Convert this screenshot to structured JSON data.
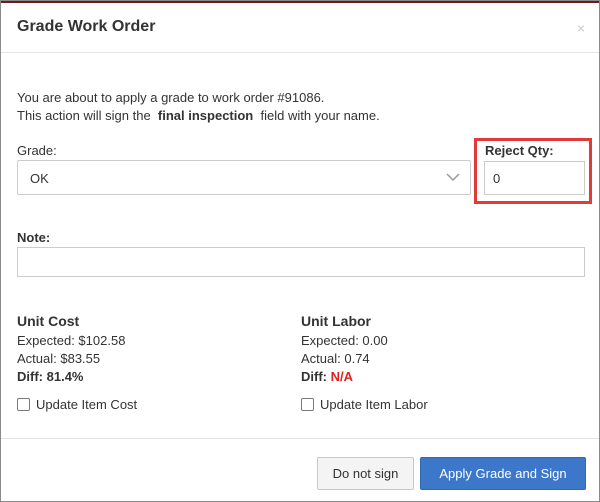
{
  "modal": {
    "title": "Grade Work Order",
    "close_glyph": "×"
  },
  "intro": {
    "line1": "You are about to apply a grade to work order #91086.",
    "line2_prefix": "This action will sign the",
    "line2_bold": "final inspection",
    "line2_suffix": "field with your name."
  },
  "grade": {
    "label": "Grade:",
    "selected": "OK",
    "icon": "chevron-down-icon"
  },
  "reject": {
    "label": "Reject Qty:",
    "value": "0",
    "highlight_color": "#e03a3a"
  },
  "note": {
    "label": "Note:",
    "value": ""
  },
  "unit_cost": {
    "title": "Unit Cost",
    "expected": "Expected: $102.58",
    "actual": "Actual: $83.55",
    "diff_label": "Diff:",
    "diff_value": "81.4%",
    "checkbox_label": "Update Item Cost",
    "checked": false
  },
  "unit_labor": {
    "title": "Unit Labor",
    "expected": "Expected: 0.00",
    "actual": "Actual: 0.74",
    "diff_label": "Diff:",
    "diff_value": "N/A",
    "diff_color": "#e02020",
    "checkbox_label": "Update Item Labor",
    "checked": false
  },
  "footer": {
    "cancel_label": "Do not sign",
    "primary_label": "Apply Grade and Sign",
    "primary_color": "#3d77c9"
  }
}
